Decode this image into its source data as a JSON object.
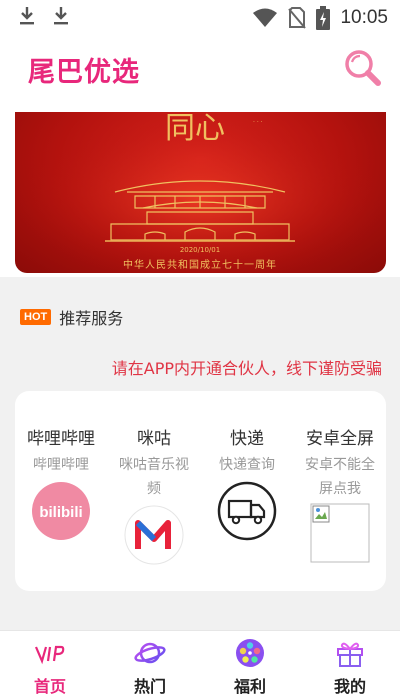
{
  "status_bar": {
    "time": "10:05",
    "icons": [
      "download-icon",
      "download-icon",
      "wifi-icon",
      "no-sim-icon",
      "battery-charging-icon"
    ]
  },
  "header": {
    "title": "尾巴优选",
    "search_icon": "search-icon"
  },
  "banner": {
    "headline": "同心",
    "date": "2020/10/01",
    "caption": "中华人民共和国成立七十一周年"
  },
  "section": {
    "badge": "HOT",
    "title": "推荐服务"
  },
  "notice": "请在APP内开通合伙人，线下谨防受骗",
  "services": [
    {
      "name": "哔哩哔哩",
      "desc": "哔哩哔哩",
      "icon": "bilibili-icon"
    },
    {
      "name": "咪咕",
      "desc": "咪咕音乐视频",
      "icon": "migu-icon"
    },
    {
      "name": "快递",
      "desc": "快递查询",
      "icon": "truck-icon"
    },
    {
      "name": "安卓全屏",
      "desc": "安卓不能全屏点我",
      "icon": "broken-image-icon"
    }
  ],
  "bottom_nav": [
    {
      "label": "首页",
      "icon": "vip-icon",
      "active": true
    },
    {
      "label": "热门",
      "icon": "planet-icon",
      "active": false
    },
    {
      "label": "福利",
      "icon": "film-reel-icon",
      "active": false
    },
    {
      "label": "我的",
      "icon": "gift-icon",
      "active": false
    }
  ],
  "colors": {
    "brand": "#e8277b",
    "notice": "#e03545",
    "hot_badge": "#ff6a00",
    "banner_red": "#c8161d",
    "gold": "#f0c060"
  }
}
